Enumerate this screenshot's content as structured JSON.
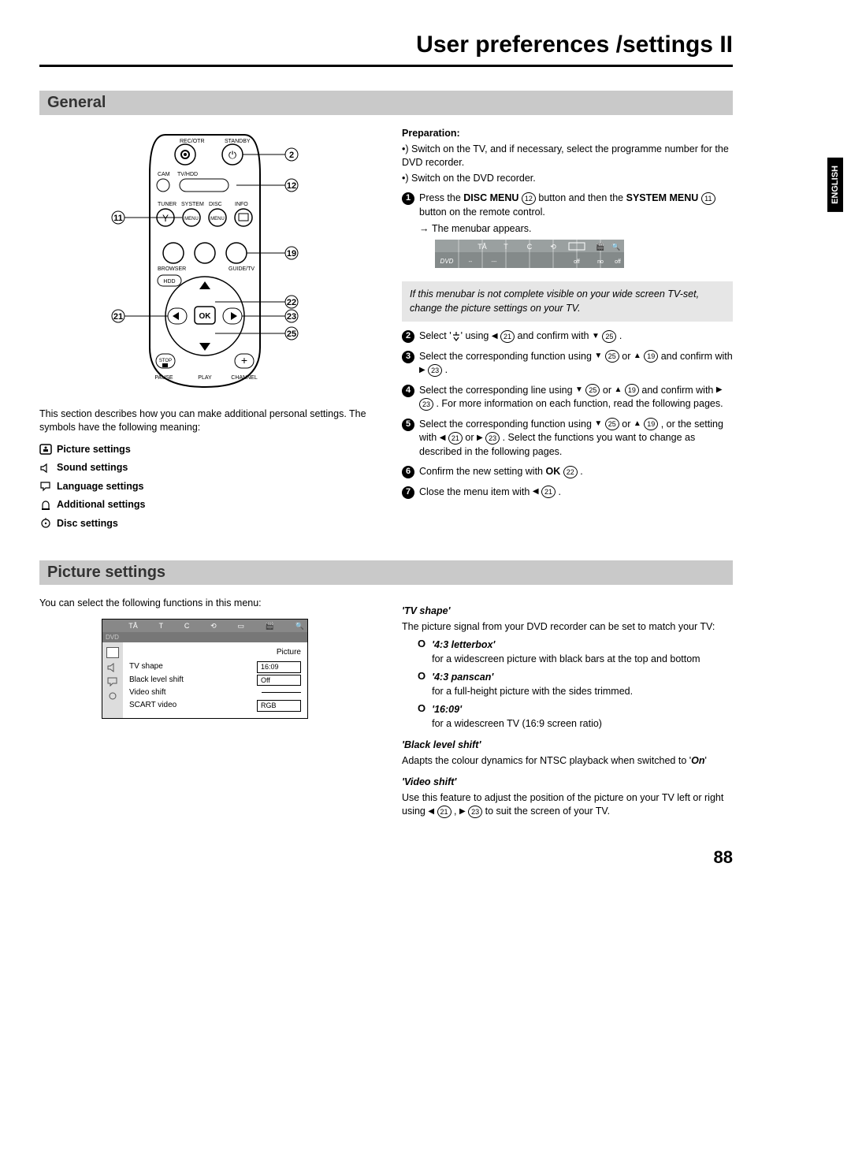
{
  "page_title": "User preferences /settings II",
  "side_tab": "ENGLISH",
  "page_number": "88",
  "section_general": "General",
  "section_picture": "Picture settings",
  "left": {
    "intro": "This section describes how you can make additional personal settings. The symbols have the following meaning:",
    "settings": {
      "picture": "Picture settings",
      "sound": "Sound settings",
      "language": "Language settings",
      "additional": "Additional settings",
      "disc": "Disc settings"
    },
    "remote_labels": {
      "rec": "REC/OTR",
      "standby": "STANDBY",
      "cam": "CAM",
      "tvhdd": "TV/HDD",
      "tuner": "TUNER",
      "system": "SYSTEM",
      "disc": "DISC",
      "info": "INFO",
      "menu": "MENU",
      "browser": "BROWSER",
      "guide": "GUIDE/TV",
      "hdd": "HDD",
      "ok": "OK",
      "stop": "STOP",
      "pause": "PAUSE",
      "play": "PLAY",
      "channel": "CHANNEL"
    },
    "callouts": {
      "c2": "2",
      "c11": "11",
      "c12": "12",
      "c19": "19",
      "c21": "21",
      "c22": "22",
      "c23": "23",
      "c25": "25"
    }
  },
  "right": {
    "prep_title": "Preparation:",
    "prep1": "•) Switch on the TV, and if necessary, select the programme number for the DVD recorder.",
    "prep2": "•) Switch on the DVD recorder.",
    "step1_a": "Press the ",
    "step1_disc": "DISC MENU",
    "step1_b": " button and then the ",
    "step1_sys": "SYSTEM MENU",
    "step1_c": " button on the remote control.",
    "step1_sub": "The menubar appears.",
    "menubar_labels": {
      "dvd": "DVD",
      "off1": "off",
      "no": "no",
      "off2": "off"
    },
    "note": "If this menubar is not complete visible on your wide screen TV-set, change the picture settings on your TV.",
    "step2_a": "Select '",
    "step2_b": "' using ",
    "step2_c": " and confirm with ",
    "step2_d": " .",
    "step3_a": "Select the corresponding function using ",
    "step3_b": " or ",
    "step3_c": " and confirm with ",
    "step3_d": " .",
    "step4_a": "Select the corresponding line using ",
    "step4_b": " or ",
    "step4_c": " and confirm with ",
    "step4_d": " . For more information on each function, read the following pages.",
    "step5_a": "Select the corresponding function using ",
    "step5_b": " or ",
    "step5_c": " , or the setting with ",
    "step5_d": " or ",
    "step5_e": " . Select the functions you want to change as described in the following pages.",
    "step6_a": "Confirm the new setting with ",
    "step6_ok": "OK",
    "step6_b": " .",
    "step7_a": "Close the menu item with ",
    "step7_b": " ."
  },
  "picture_left": {
    "intro": "You can select the following functions in this menu:",
    "osd_title": "Picture",
    "rows": {
      "tvshape_l": "TV shape",
      "tvshape_v": "16:09",
      "black_l": "Black level shift",
      "black_v": "Off",
      "video_l": "Video shift",
      "video_v": "",
      "scart_l": "SCART video",
      "scart_v": "RGB"
    }
  },
  "picture_right": {
    "tvshape_h": "'TV shape'",
    "tvshape_d": "The picture signal from your DVD recorder can be set to match your TV:",
    "opt1_l": "'4:3 letterbox'",
    "opt1_d": "for a widescreen picture with black bars at the top and bottom",
    "opt2_l": "'4:3 panscan'",
    "opt2_d": "for a full-height picture with the sides trimmed.",
    "opt3_l": "'16:09'",
    "opt3_d": "for a widescreen TV (16:9 screen ratio)",
    "black_h": "'Black level shift'",
    "black_d_a": "Adapts the colour dynamics for NTSC playback when switched to '",
    "black_on": "On",
    "black_d_b": "'",
    "video_h": "'Video shift'",
    "video_d_a": "Use this feature to adjust the position of the picture on your TV left or right using ",
    "video_d_b": " , ",
    "video_d_c": " to suit the screen of your TV."
  }
}
